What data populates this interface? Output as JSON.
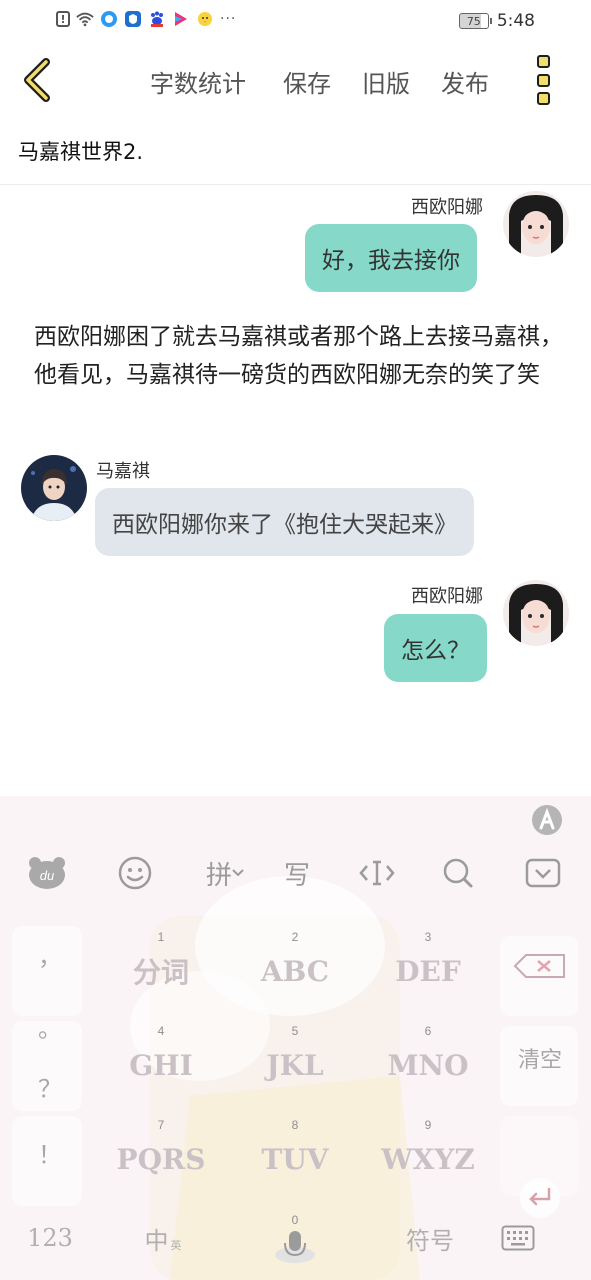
{
  "status_bar": {
    "alert_glyph": "!",
    "more_glyph": "···",
    "battery_level": "75",
    "time": "5:48",
    "icons": [
      "alert-icon",
      "wifi-icon",
      "app-notification-icon",
      "shield-app-icon",
      "baidu-paw-icon",
      "video-app-icon",
      "chick-app-icon",
      "more-notifications-icon",
      "battery-icon"
    ]
  },
  "app_bar": {
    "back_icon": "chevron-left-icon",
    "word_count_label": "字数统计",
    "save_label": "保存",
    "old_version_label": "旧版",
    "publish_label": "发布",
    "more_icon": "more-vertical-icon",
    "accent_color": "#f3dd6b"
  },
  "document": {
    "title": "马嘉祺世界2."
  },
  "chat": {
    "messages": [
      {
        "speaker": "西欧阳娜",
        "side": "right",
        "text": "好，我去接你"
      },
      {
        "speaker": "马嘉祺",
        "side": "left",
        "text": "西欧阳娜你来了《抱住大哭起来》"
      },
      {
        "speaker": "西欧阳娜",
        "side": "right",
        "text": "怎么？"
      }
    ],
    "narration": "西欧阳娜困了就去马嘉祺或者那个路上去接马嘉祺，他看见，马嘉祺待一磅货的西欧阳娜无奈的笑了笑",
    "right_bubble_color": "#86d9c9",
    "left_bubble_color": "#e1e6ec"
  },
  "keyboard": {
    "toolbar": {
      "logo_text": "du",
      "pinyin_label": "拼",
      "handwrite_label": "写",
      "icons": [
        "du-bear-logo-icon",
        "emoji-icon",
        "pinyin-dropdown-icon",
        "handwriting-icon",
        "text-cursor-icon",
        "search-icon",
        "hide-keyboard-icon",
        "ai-assistant-icon"
      ]
    },
    "punctuation": [
      "，",
      "。",
      "？",
      "！"
    ],
    "keys": [
      {
        "digit": "1",
        "label": "分词"
      },
      {
        "digit": "2",
        "label": "ABC"
      },
      {
        "digit": "3",
        "label": "DEF"
      },
      {
        "digit": "4",
        "label": "GHI"
      },
      {
        "digit": "5",
        "label": "JKL"
      },
      {
        "digit": "6",
        "label": "MNO"
      },
      {
        "digit": "7",
        "label": "PQRS"
      },
      {
        "digit": "8",
        "label": "TUV"
      },
      {
        "digit": "9",
        "label": "WXYZ"
      }
    ],
    "clear_label": "清空",
    "delete_icon": "backspace-icon",
    "enter_icon": "enter-icon",
    "bottom": {
      "numbers_label": "123",
      "zh_label": "中",
      "zh_sub": "英",
      "space_digit": "0",
      "symbols_label": "符号",
      "keyboard_switch_icon": "keyboard-icon",
      "mic_icon": "microphone-icon"
    }
  }
}
